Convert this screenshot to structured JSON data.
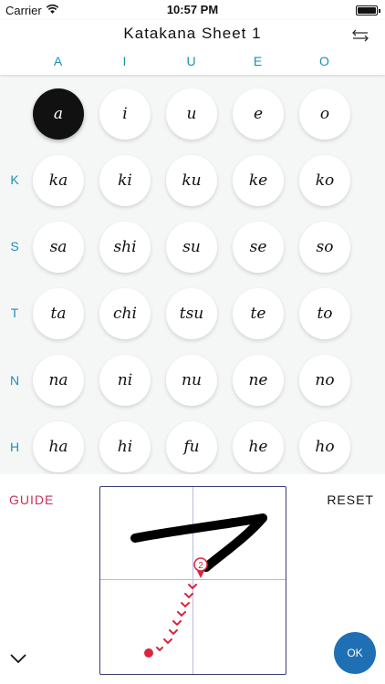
{
  "status_bar": {
    "carrier": "Carrier",
    "time": "10:57 PM"
  },
  "nav": {
    "title": "Katakana Sheet 1"
  },
  "vowels": [
    "A",
    "I",
    "U",
    "E",
    "O"
  ],
  "rows": [
    {
      "label": "",
      "cells": [
        "a",
        "i",
        "u",
        "e",
        "o"
      ]
    },
    {
      "label": "K",
      "cells": [
        "ka",
        "ki",
        "ku",
        "ke",
        "ko"
      ]
    },
    {
      "label": "S",
      "cells": [
        "sa",
        "shi",
        "su",
        "se",
        "so"
      ]
    },
    {
      "label": "T",
      "cells": [
        "ta",
        "chi",
        "tsu",
        "te",
        "to"
      ]
    },
    {
      "label": "N",
      "cells": [
        "na",
        "ni",
        "nu",
        "ne",
        "no"
      ]
    },
    {
      "label": "H",
      "cells": [
        "ha",
        "hi",
        "fu",
        "he",
        "ho"
      ]
    }
  ],
  "selected": "a",
  "bottom": {
    "guide_label": "GUIDE",
    "reset_label": "RESET",
    "ok_label": "OK",
    "stroke_number": "2"
  },
  "colors": {
    "accent_blue": "#1d8fb5",
    "guide_pink": "#c8325a",
    "stroke_red": "#d8263f",
    "ok_blue": "#1f6fb4"
  }
}
